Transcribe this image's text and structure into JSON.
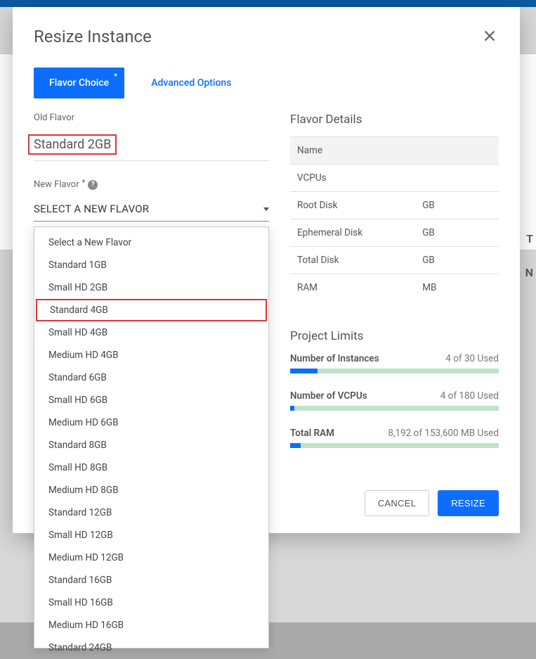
{
  "modal": {
    "title": "Resize Instance",
    "tab_flavor": "Flavor Choice",
    "tab_advanced": "Advanced Options",
    "old_flavor_label": "Old Flavor",
    "old_flavor_value": "Standard 2GB",
    "new_flavor_label": "New Flavor",
    "select_placeholder": "SELECT A NEW FLAVOR",
    "cancel": "CANCEL",
    "submit": "RESIZE"
  },
  "dropdown": {
    "items": [
      "Select a New Flavor",
      "Standard 1GB",
      "Small HD 2GB",
      "Standard 4GB",
      "Small HD 4GB",
      "Medium HD 4GB",
      "Standard 6GB",
      "Small HD 6GB",
      "Medium HD 6GB",
      "Standard 8GB",
      "Small HD 8GB",
      "Medium HD 8GB",
      "Standard 12GB",
      "Small HD 12GB",
      "Medium HD 12GB",
      "Standard 16GB",
      "Small HD 16GB",
      "Medium HD 16GB",
      "Standard 24GB"
    ],
    "highlighted_index": 3
  },
  "details": {
    "title": "Flavor Details",
    "rows": [
      {
        "label": "Name",
        "value": ""
      },
      {
        "label": "VCPUs",
        "value": ""
      },
      {
        "label": "Root Disk",
        "value": "GB"
      },
      {
        "label": "Ephemeral Disk",
        "value": "GB"
      },
      {
        "label": "Total Disk",
        "value": "GB"
      },
      {
        "label": "RAM",
        "value": "MB"
      }
    ]
  },
  "limits": {
    "title": "Project Limits",
    "rows": [
      {
        "label": "Number of Instances",
        "usage": "4 of 30 Used",
        "pct": 13
      },
      {
        "label": "Number of VCPUs",
        "usage": "4 of 180 Used",
        "pct": 2
      },
      {
        "label": "Total RAM",
        "usage": "8,192 of 153,600 MB Used",
        "pct": 5
      }
    ]
  },
  "bg": {
    "col_t": "T",
    "col_n": "N"
  }
}
